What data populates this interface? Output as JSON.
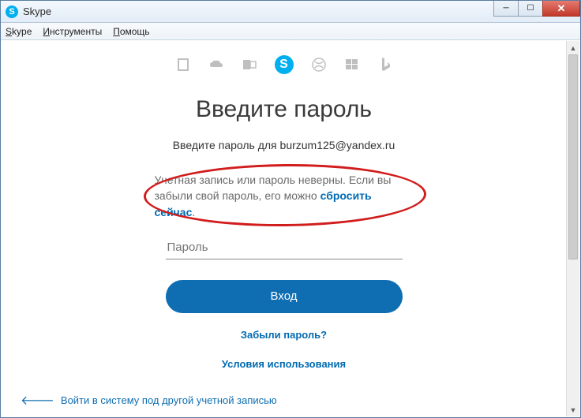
{
  "window": {
    "title": "Skype"
  },
  "menubar": {
    "items": [
      "Skype",
      "Инструменты",
      "Помощь"
    ]
  },
  "services": [
    "office",
    "onedrive",
    "outlook",
    "skype",
    "xbox",
    "windows",
    "bing"
  ],
  "main": {
    "heading": "Введите пароль",
    "subheading": "Введите пароль для burzum125@yandex.ru",
    "error_text": "Учетная запись или пароль неверны. Если вы забыли свой пароль, его можно ",
    "error_link": "сбросить сейчас",
    "error_tail": ".",
    "password_placeholder": "Пароль",
    "login_button": "Вход",
    "forgot_link": "Забыли пароль?",
    "terms_link": "Условия использования",
    "back_link": "Войти в систему под другой учетной записью"
  }
}
